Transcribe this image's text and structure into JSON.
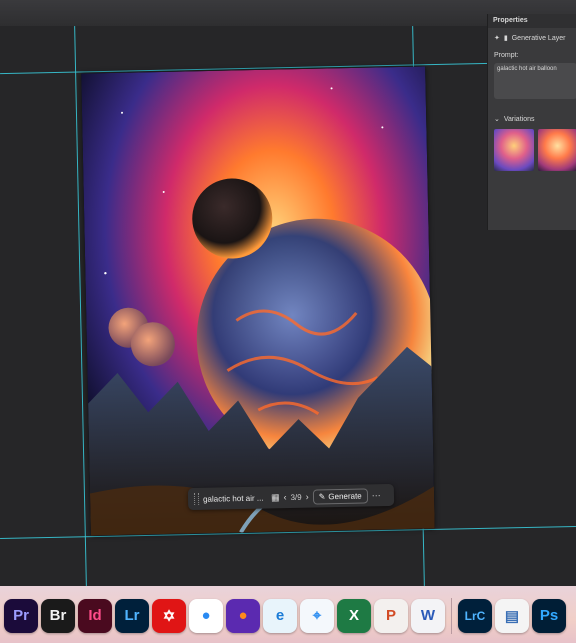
{
  "properties_panel": {
    "title": "Properties",
    "layer_type": "Generative Layer",
    "prompt_label": "Prompt:",
    "prompt_value": "galactic hot air balloon",
    "variations_label": "Variations"
  },
  "contextual_taskbar": {
    "prompt_text": "galactic hot air ...",
    "counter": "3/9",
    "generate_label": "Generate",
    "more_label": "···"
  },
  "dock": {
    "apps": [
      {
        "name": "premiere-pro-app",
        "label": "Pr",
        "bg": "#1b0b3a",
        "fg": "#9c9cff"
      },
      {
        "name": "bridge-app",
        "label": "Br",
        "bg": "#1a1a1a",
        "fg": "#f2f2f2"
      },
      {
        "name": "indesign-app",
        "label": "Id",
        "bg": "#4a0a1f",
        "fg": "#ff4c8a"
      },
      {
        "name": "lightroom-classic-app",
        "label": "Lr",
        "bg": "#00203b",
        "fg": "#4fb4ff"
      },
      {
        "name": "acrobat-app",
        "label": "✡",
        "bg": "#e01515",
        "fg": "#ffffff"
      },
      {
        "name": "chrome-app",
        "label": "●",
        "bg": "#ffffff",
        "fg": "#2a8af2"
      },
      {
        "name": "firefox-app",
        "label": "●",
        "bg": "#5b2ab0",
        "fg": "#ff8a1a"
      },
      {
        "name": "edge-app",
        "label": "e",
        "bg": "#e8f4fb",
        "fg": "#1a7bd6"
      },
      {
        "name": "safari-app",
        "label": "⌖",
        "bg": "#f4f8fc",
        "fg": "#2a8cf0"
      },
      {
        "name": "excel-app",
        "label": "X",
        "bg": "#1e7a44",
        "fg": "#ffffff"
      },
      {
        "name": "powerpoint-app",
        "label": "P",
        "bg": "#f3f0ee",
        "fg": "#d24b25"
      },
      {
        "name": "word-app",
        "label": "W",
        "bg": "#f3f3f6",
        "fg": "#2b5ab8"
      },
      {
        "name": "lightroom-app",
        "label": "LrC",
        "bg": "#00203b",
        "fg": "#4fb4ff"
      },
      {
        "name": "preview-app",
        "label": "▤",
        "bg": "#f4f4f4",
        "fg": "#3a6fb5"
      },
      {
        "name": "photoshop-app",
        "label": "Ps",
        "bg": "#001e36",
        "fg": "#31a8ff"
      }
    ]
  },
  "colors": {
    "guide": "#39c7d6",
    "workspace": "#262628"
  }
}
